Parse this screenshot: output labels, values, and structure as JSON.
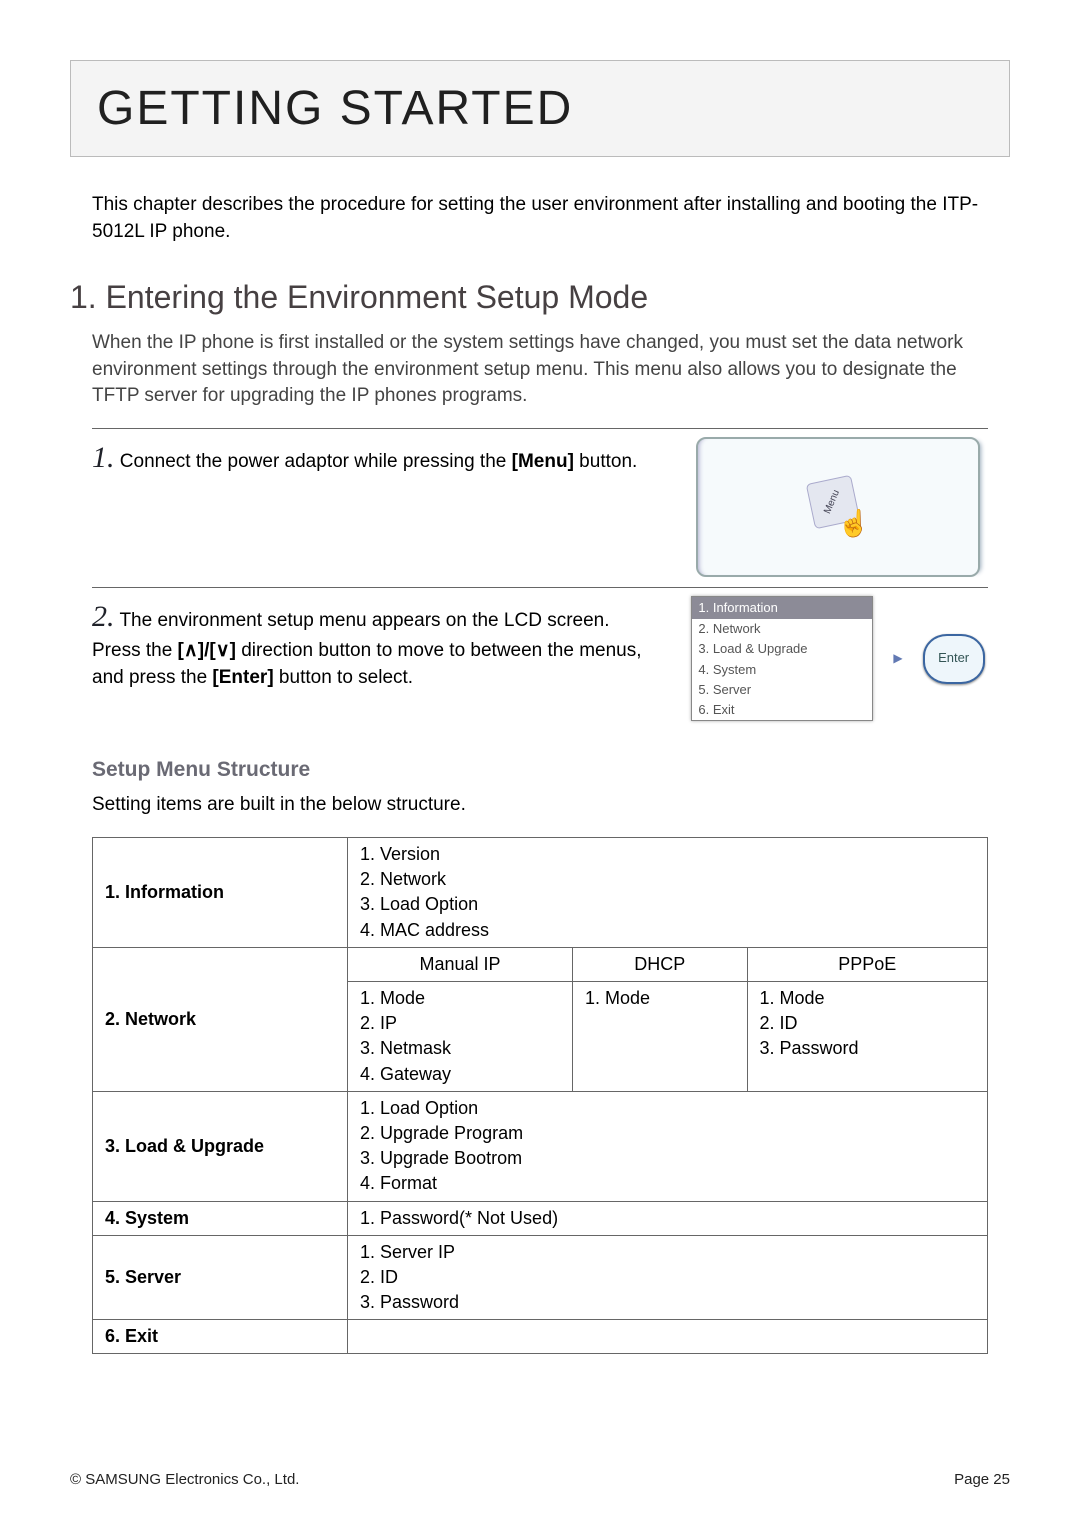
{
  "chapter_title": "GETTING STARTED",
  "intro": "This chapter describes the procedure for setting the user environment after installing and booting the ITP-5012L IP phone.",
  "section": {
    "number_title": "1. Entering the Environment Setup Mode",
    "desc": "When the IP phone is first installed or the system settings have changed, you must set the data network environment settings through the environment setup menu. This menu also allows you to designate the TFTP server for upgrading the IP phones programs."
  },
  "steps": {
    "s1": {
      "num": "1.",
      "text_a": " Connect the power adaptor while pressing the ",
      "bold": "[Menu]",
      "text_b": " button.",
      "menu_key_label": "Menu"
    },
    "s2": {
      "num": "2.",
      "text_a": " The environment setup menu appears on the LCD screen.",
      "line2_a": "Press the ",
      "line2_dir": "[∧]/[∨]",
      "line2_b": " direction button to move to between the menus, and press the ",
      "line2_bold": "[Enter]",
      "line2_c": " button to select."
    }
  },
  "lcd_menu": {
    "items": [
      "1. Information",
      "2. Network",
      "3. Load & Upgrade",
      "4. System",
      "5. Server",
      "6. Exit"
    ],
    "enter_label": "Enter"
  },
  "sub_heading": "Setup Menu Structure",
  "sub_desc": "Setting items are built in the below structure.",
  "chart_data": {
    "type": "table",
    "rows": [
      {
        "head": "1. Information",
        "cells": [
          [
            "1. Version",
            "2. Network",
            "3. Load Option",
            "4. MAC address"
          ]
        ]
      },
      {
        "head": "2. Network",
        "header_row": [
          "Manual IP",
          "DHCP",
          "PPPoE"
        ],
        "cols": [
          [
            "1. Mode",
            "2. IP",
            "3. Netmask",
            "4. Gateway"
          ],
          [
            "1. Mode"
          ],
          [
            "1. Mode",
            "2. ID",
            "3. Password"
          ]
        ]
      },
      {
        "head": "3. Load & Upgrade",
        "cells": [
          [
            "1. Load Option",
            "2. Upgrade Program",
            "3. Upgrade Bootrom",
            "4. Format"
          ]
        ]
      },
      {
        "head": "4. System",
        "cells": [
          [
            "1. Password(* Not Used)"
          ]
        ]
      },
      {
        "head": "5. Server",
        "cells": [
          [
            "1. Server IP",
            "2. ID",
            "3. Password"
          ]
        ]
      },
      {
        "head": "6. Exit",
        "cells": [
          [
            ""
          ]
        ]
      }
    ]
  },
  "footer": {
    "left": "© SAMSUNG Electronics Co., Ltd.",
    "right": "Page 25"
  }
}
